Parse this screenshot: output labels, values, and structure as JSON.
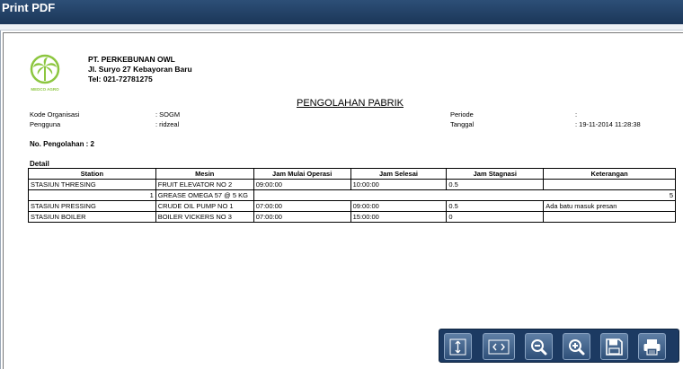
{
  "window": {
    "title": "Print PDF"
  },
  "company": {
    "name": "PT. PERKEBUNAN OWL",
    "address": "Jl. Suryo 27 Kebayoran Baru",
    "phone": "Tel: 021-72781275",
    "logo_text": "MEDCO AGRO"
  },
  "report": {
    "title": "PENGOLAHAN PABRIK",
    "kode_label": "Kode Organisasi",
    "kode_value": ": SOGM",
    "pengguna_label": "Pengguna",
    "pengguna_value": ": ridzeal",
    "periode_label": "Periode",
    "periode_value": ":",
    "tanggal_label": "Tanggal",
    "tanggal_value": ": 19-11-2014 11:28:38",
    "no_pengolahan": "No. Pengolahan : 2",
    "detail_label": "Detail"
  },
  "table": {
    "headers": [
      "Station",
      "Mesin",
      "Jam Mulai Operasi",
      "Jam Selesai",
      "Jam Stagnasi",
      "Keterangan"
    ],
    "rows": [
      {
        "station": "STASIUN THRESING",
        "mesin": "FRUIT ELEVATOR NO 2",
        "mulai": "09:00:00",
        "selesai": "10:00:00",
        "stagnasi": "0.5",
        "keterangan": ""
      },
      {
        "station": "1",
        "mesin": "GREASE OMEGA 57 @ 5 KG",
        "mulai": "",
        "selesai": "",
        "stagnasi": "",
        "keterangan": "5"
      },
      {
        "station": "STASIUN PRESSING",
        "mesin": "CRUDE OIL PUMP NO 1",
        "mulai": "07:00:00",
        "selesai": "09:00:00",
        "stagnasi": "0.5",
        "keterangan": "Ada batu masuk presan"
      },
      {
        "station": "STASIUN BOILER",
        "mesin": "BOILER VICKERS NO 3",
        "mulai": "07:00:00",
        "selesai": "15:00:00",
        "stagnasi": "0",
        "keterangan": ""
      }
    ]
  },
  "toolbar": {
    "buttons": [
      {
        "name": "fit-page-button",
        "icon": "fit-page-icon"
      },
      {
        "name": "fit-width-button",
        "icon": "fit-width-icon"
      },
      {
        "name": "zoom-out-button",
        "icon": "zoom-out-icon"
      },
      {
        "name": "zoom-in-button",
        "icon": "zoom-in-icon"
      },
      {
        "name": "save-button",
        "icon": "floppy-disk-icon"
      },
      {
        "name": "print-button",
        "icon": "printer-icon"
      }
    ]
  }
}
